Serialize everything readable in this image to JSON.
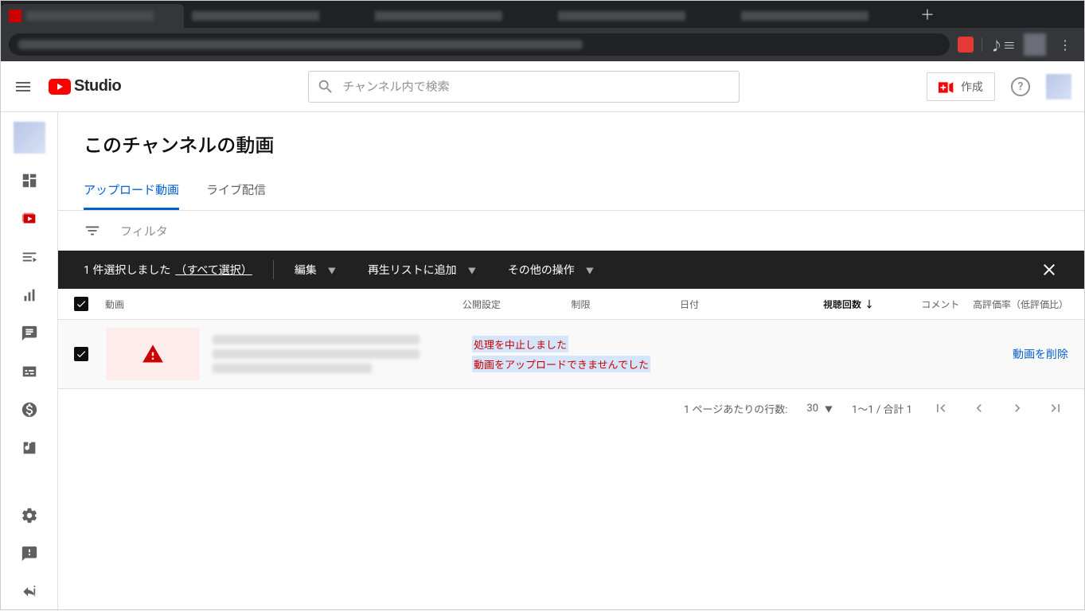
{
  "header": {
    "logo_text": "Studio",
    "search_placeholder": "チャンネル内で検索",
    "create_label": "作成"
  },
  "page": {
    "title": "このチャンネルの動画",
    "tabs": [
      {
        "label": "アップロード動画",
        "active": true
      },
      {
        "label": "ライブ配信",
        "active": false
      }
    ],
    "filter_label": "フィルタ"
  },
  "bulk": {
    "selected_text": "1 件選択しました",
    "select_all": "（すべて選択）",
    "actions": {
      "edit": "編集",
      "add_to_playlist": "再生リストに追加",
      "more": "その他の操作"
    }
  },
  "columns": {
    "video": "動画",
    "visibility": "公開設定",
    "restrictions": "制限",
    "date": "日付",
    "views": "視聴回数",
    "comments": "コメント",
    "likes": "高評価率（低評価比）"
  },
  "row": {
    "status1": "処理を中止しました",
    "status2": "動画をアップロードできませんでした",
    "delete_label": "動画を削除"
  },
  "pager": {
    "rows_label": "1 ページあたりの行数:",
    "rows_value": "30",
    "range": "1～1 / 合計 1"
  }
}
